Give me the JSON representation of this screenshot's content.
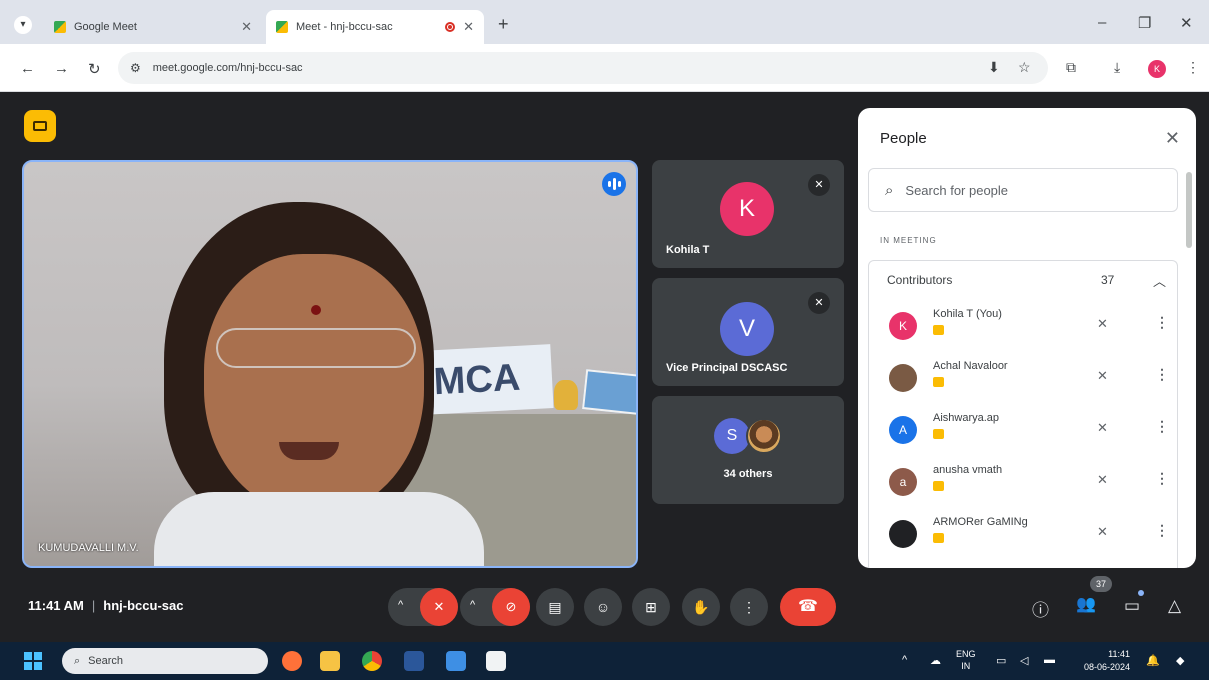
{
  "browser": {
    "tabs": [
      {
        "title": "Google Meet",
        "active": false
      },
      {
        "title": "Meet - hnj-bccu-sac",
        "active": true
      }
    ],
    "new_tab": "+",
    "url": "meet.google.com/hnj-bccu-sac",
    "profile_initial": "K"
  },
  "meeting": {
    "code": "hnj-bccu-sac",
    "time": "11:41 AM",
    "main_speaker": "KUMUDAVALLI M.V.",
    "background_sign": "MCA",
    "side_tiles": [
      {
        "initial": "K",
        "name": "Kohila T",
        "color": "#e8336a"
      },
      {
        "initial": "V",
        "name": "Vice Principal DSCASC",
        "color": "#5b6bd6"
      }
    ],
    "others": {
      "initial": "S",
      "label": "34 others"
    },
    "participant_count": "37"
  },
  "people_panel": {
    "title": "People",
    "search_placeholder": "Search for people",
    "section_label": "IN MEETING",
    "group_label": "Contributors",
    "group_count": "37",
    "participants": [
      {
        "name": "Kohila T (You)",
        "initial": "K",
        "color": "#e8336a"
      },
      {
        "name": "Achal Navaloor",
        "initial": "",
        "color": "#7a5a44"
      },
      {
        "name": "Aishwarya.ap",
        "initial": "A",
        "color": "#1a73e8"
      },
      {
        "name": "anusha vmath",
        "initial": "a",
        "color": "#8d5a4a"
      },
      {
        "name": "ARMORer GaMINg",
        "initial": "",
        "color": "#202124"
      }
    ]
  },
  "taskbar": {
    "search_placeholder": "Search",
    "lang_top": "ENG",
    "lang_bottom": "IN",
    "time": "11:41",
    "date": "08-06-2024"
  },
  "colors": {
    "meet_bg": "#202124",
    "accent_blue": "#8ab4f8",
    "end_call_red": "#ea4335",
    "tile_gray": "#3c4043"
  }
}
